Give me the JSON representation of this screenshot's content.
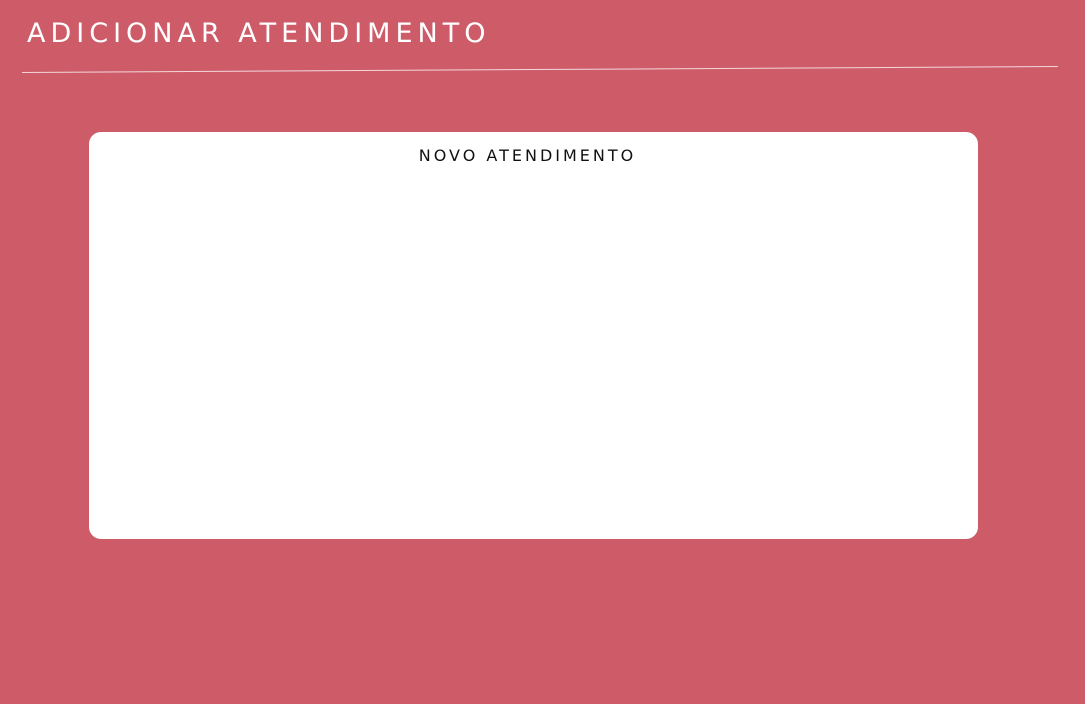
{
  "header": {
    "title": "adicionar atendimento"
  },
  "card": {
    "title": "novo atendimento"
  },
  "colors": {
    "background": "#cd5c68",
    "card_background": "#ffffff",
    "title_text": "#ffffff",
    "card_title_text": "#111111",
    "divider": "#f3d7da"
  }
}
